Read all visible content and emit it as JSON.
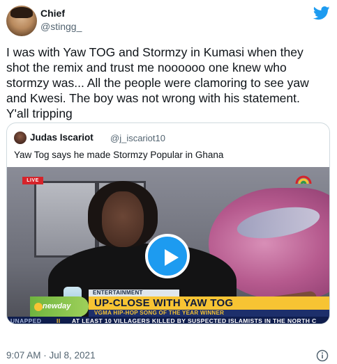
{
  "tweet": {
    "author_name": "Chief",
    "author_handle": "@stingg_",
    "text": "I was with Yaw TOG and Stormzy in Kumasi when they\nshot the remix and trust me noooooo one knew who\nstormzy was... All the people were clamoring to see yaw\nand Kwesi. The boy was not wrong with his statement.\nY'all tripping",
    "timestamp": "9:07 AM · Jul 8, 2021",
    "brand_color": "#1d9bf0",
    "icons": [
      "twitter-bird-icon",
      "info-icon",
      "play-icon"
    ]
  },
  "quoted_tweet": {
    "author_name": "Judas Iscariot",
    "author_handle": "@j_iscariot10",
    "text": "Yaw Tog says he made Stormzy Popular in Ghana",
    "video": {
      "live_badge": "LIVE",
      "section_label": "ENTERTAINMENT",
      "show_logo": "newday",
      "headline": "UP-CLOSE WITH YAW TOG",
      "subheadline": "VGMA HIP-HOP SONG OF THE YEAR WINNER",
      "crawl_left": "UNAPPED",
      "crawl_separator": "II",
      "crawl_text": "AT LEAST 10 VILLAGERS KILLED BY SUSPECTED ISLAMISTS IN THE NORTH C"
    }
  }
}
